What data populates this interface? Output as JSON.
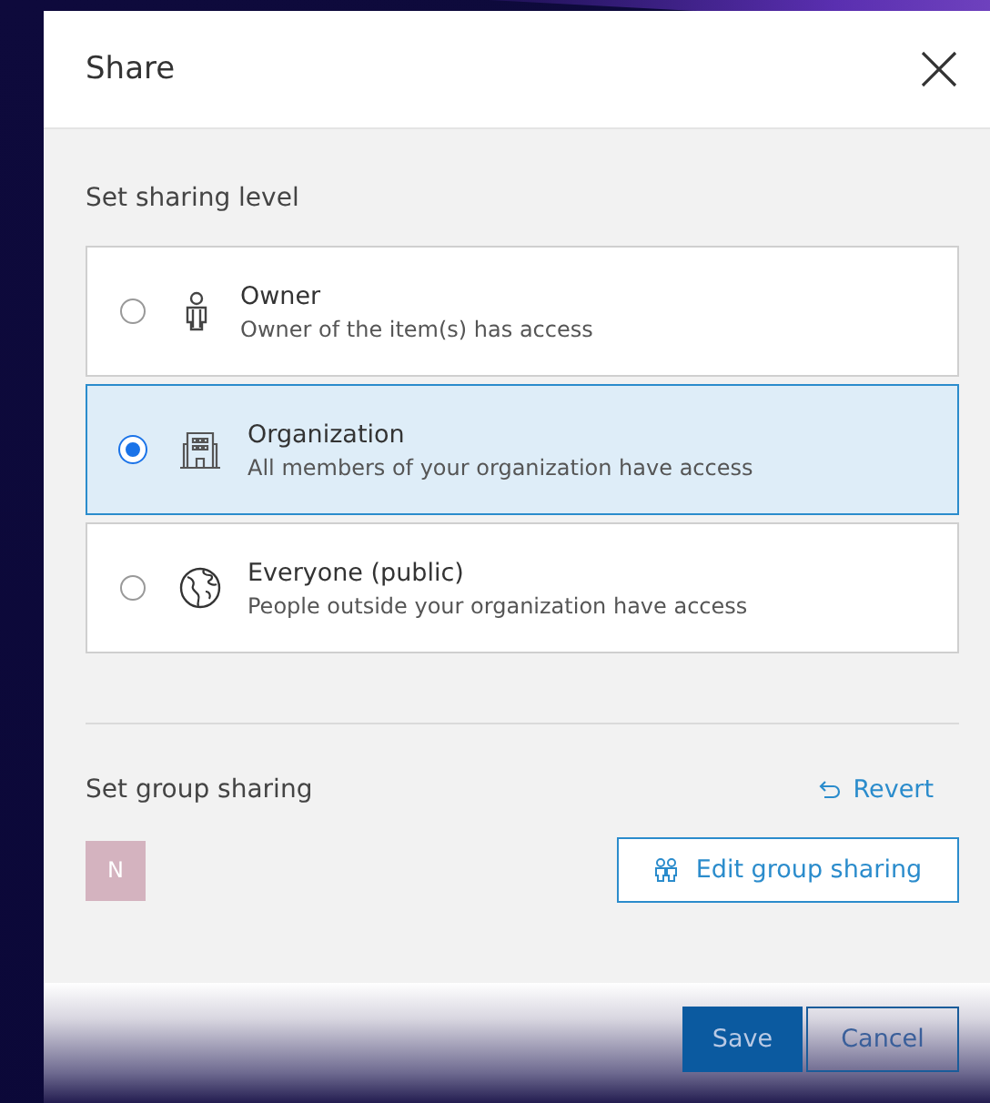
{
  "dialog": {
    "title": "Share"
  },
  "sharing_level": {
    "heading": "Set sharing level",
    "options": [
      {
        "kind": "owner",
        "label": "Owner",
        "description": "Owner of the item(s) has access",
        "selected": false
      },
      {
        "kind": "organization",
        "label": "Organization",
        "description": "All members of your organization have access",
        "selected": true
      },
      {
        "kind": "everyone",
        "label": "Everyone (public)",
        "description": "People outside your organization have access",
        "selected": false
      }
    ]
  },
  "group_sharing": {
    "heading": "Set group sharing",
    "revert": "Revert",
    "groups": [
      {
        "initial": "N",
        "color": "#d4b3bf"
      }
    ],
    "edit_button": "Edit group sharing"
  },
  "buttons": [
    {
      "kind": "primary",
      "label": "Save"
    },
    {
      "kind": "secondary",
      "label": "Cancel"
    }
  ]
}
